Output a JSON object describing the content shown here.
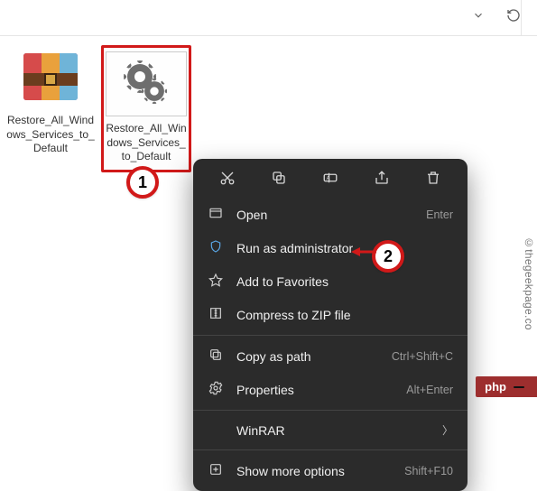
{
  "toolbar": {},
  "files": {
    "items": [
      {
        "label": "Restore_All_Windows_Services_to_Default",
        "icon": "rar-archive-icon"
      },
      {
        "label": "Restore_All_Windows_Services_to_Default",
        "icon": "batch-gears-icon"
      }
    ]
  },
  "context_menu": {
    "top_actions": [
      "cut",
      "copy",
      "rename",
      "share",
      "delete"
    ],
    "items": [
      {
        "icon": "open-icon",
        "label": "Open",
        "shortcut": "Enter"
      },
      {
        "icon": "shield-icon",
        "label": "Run as administrator",
        "shortcut": ""
      },
      {
        "icon": "star-icon",
        "label": "Add to Favorites",
        "shortcut": ""
      },
      {
        "icon": "zip-icon",
        "label": "Compress to ZIP file",
        "shortcut": ""
      },
      {
        "icon": "copy-path-icon",
        "label": "Copy as path",
        "shortcut": "Ctrl+Shift+C"
      },
      {
        "icon": "properties-icon",
        "label": "Properties",
        "shortcut": "Alt+Enter"
      }
    ],
    "submenu": {
      "icon": "winrar-icon",
      "label": "WinRAR"
    },
    "more": {
      "icon": "more-icon",
      "label": "Show more options",
      "shortcut": "Shift+F10"
    }
  },
  "callouts": {
    "one": "1",
    "two": "2"
  },
  "watermark": "©thegeekpage.co",
  "badge": {
    "text": "php",
    "tag": ""
  }
}
